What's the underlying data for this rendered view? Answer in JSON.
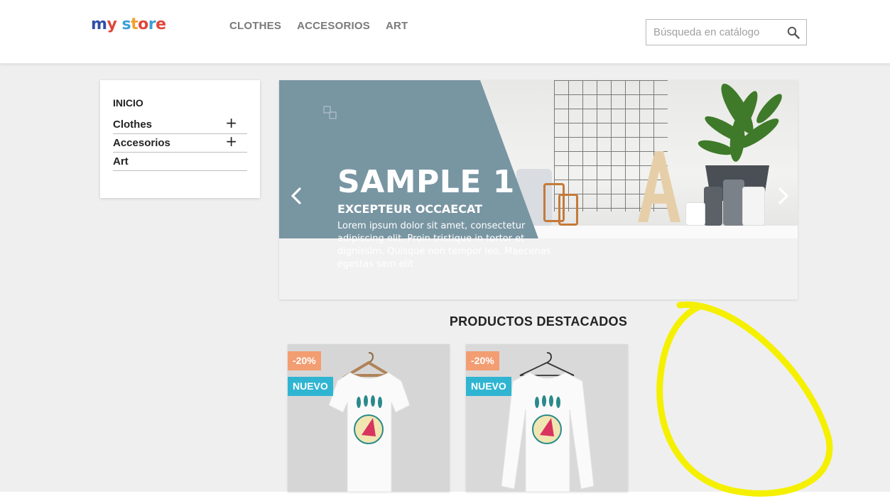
{
  "header": {
    "logo_text": "my store",
    "nav": [
      {
        "label": "CLOTHES"
      },
      {
        "label": "ACCESORIOS"
      },
      {
        "label": "ART"
      }
    ],
    "search": {
      "placeholder": "Búsqueda en catálogo",
      "value": ""
    }
  },
  "sidebar": {
    "title": "INICIO",
    "categories": [
      {
        "label": "Clothes",
        "expand_icon": "plus-icon"
      },
      {
        "label": "Accesorios",
        "expand_icon": "plus-icon"
      },
      {
        "label": "Art"
      }
    ]
  },
  "slider": {
    "title": "SAMPLE 1",
    "subtitle": "EXCEPTEUR OCCAECAT",
    "text": "Lorem ipsum dolor sit amet, consectetur adipiscing elit. Proin tristique in tortor et dignissim. Quisque non tempor leo. Maecenas egestas sem elit",
    "prev_icon": "chevron-left-icon",
    "next_icon": "chevron-right-icon",
    "band_color": "#7895a2"
  },
  "featured": {
    "title": "PRODUCTOS DESTACADOS",
    "products": [
      {
        "discount": "-20%",
        "new_label": "NUEVO",
        "image": "t-shirt-image"
      },
      {
        "discount": "-20%",
        "new_label": "NUEVO",
        "image": "long-sleeve-shirt-image"
      }
    ]
  },
  "colors": {
    "discount_badge": "#f39d72",
    "new_badge": "#2fb5d2",
    "annotation": "#f5f000"
  }
}
